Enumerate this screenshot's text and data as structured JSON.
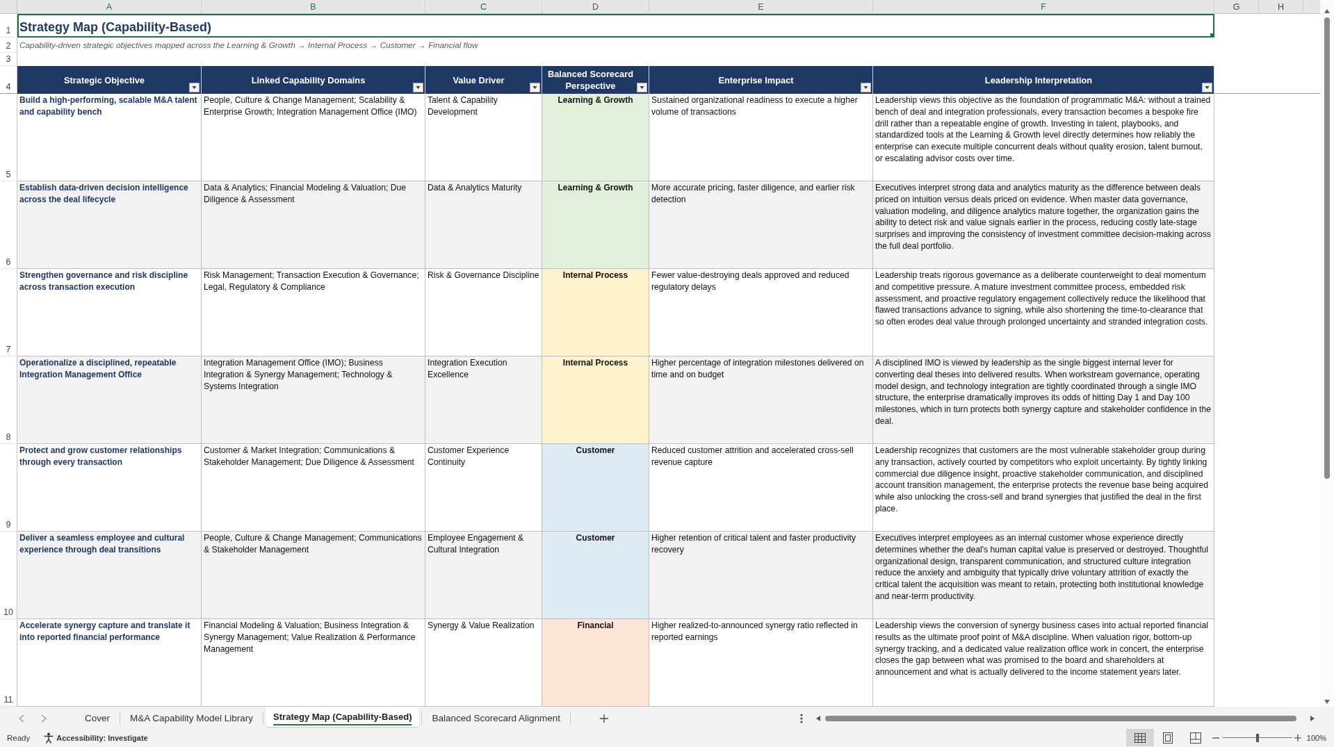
{
  "column_headers": [
    {
      "label": "A",
      "selected": true
    },
    {
      "label": "B",
      "selected": true
    },
    {
      "label": "C",
      "selected": true
    },
    {
      "label": "D",
      "selected": true
    },
    {
      "label": "E",
      "selected": true
    },
    {
      "label": "F",
      "selected": true
    },
    {
      "label": "G",
      "selected": false
    },
    {
      "label": "H",
      "selected": false
    }
  ],
  "row_headers": [
    {
      "label": "1",
      "selected": true
    },
    {
      "label": "2",
      "selected": false
    },
    {
      "label": "3",
      "selected": false
    },
    {
      "label": "4",
      "selected": false
    },
    {
      "label": "5",
      "selected": false
    },
    {
      "label": "6",
      "selected": false
    },
    {
      "label": "7",
      "selected": false
    },
    {
      "label": "8",
      "selected": false
    },
    {
      "label": "9",
      "selected": false
    },
    {
      "label": "10",
      "selected": false
    },
    {
      "label": "11",
      "selected": false
    }
  ],
  "title": {
    "text": "Strategy Map (Capability-Based)",
    "selected": true
  },
  "subtitle": "Capability-driven strategic objectives mapped across the Learning & Growth → Internal Process → Customer → Financial flow",
  "table": {
    "columns": [
      {
        "label": "Strategic Objective",
        "filter": true
      },
      {
        "label": "Linked Capability Domains",
        "filter": true
      },
      {
        "label": "Value Driver",
        "filter": true
      },
      {
        "label": "Balanced Scorecard Perspective",
        "filter": true
      },
      {
        "label": "Enterprise Impact",
        "filter": true
      },
      {
        "label": "Leadership Interpretation",
        "filter": true
      }
    ],
    "rows": [
      {
        "objective": "Build a high-performing, scalable M&A talent and capability bench",
        "capability_domains": "People, Culture & Change Management; Scalability & Enterprise Growth; Integration Management Office (IMO)",
        "value_driver": "Talent & Capability Development",
        "perspective": {
          "label": "Learning & Growth",
          "color": "#e2efda"
        },
        "enterprise_impact": "Sustained organizational readiness to execute a higher volume of transactions",
        "leadership_interpretation": "Leadership views this objective as the foundation of programmatic M&A: without a trained bench of deal and integration professionals, every transaction becomes a bespoke fire drill rather than a repeatable engine of growth. Investing in talent, playbooks, and standardized tools at the Learning & Growth level directly determines how reliably the enterprise can execute multiple concurrent deals without quality erosion, talent burnout, or escalating advisor costs over time."
      },
      {
        "objective": "Establish data-driven decision intelligence across the deal lifecycle",
        "capability_domains": "Data & Analytics; Financial Modeling & Valuation; Due Diligence & Assessment",
        "value_driver": "Data & Analytics Maturity",
        "perspective": {
          "label": "Learning & Growth",
          "color": "#e2efda"
        },
        "enterprise_impact": "More accurate pricing, faster diligence, and earlier risk detection",
        "leadership_interpretation": "Executives interpret strong data and analytics maturity as the difference between deals priced on intuition versus deals priced on evidence. When master data governance, valuation modeling, and diligence analytics mature together, the organization gains the ability to detect risk and value signals earlier in the process, reducing costly late-stage surprises and improving the consistency of investment committee decision-making across the full deal portfolio."
      },
      {
        "objective": "Strengthen governance and risk discipline across transaction execution",
        "capability_domains": "Risk Management; Transaction Execution & Governance; Legal, Regulatory & Compliance",
        "value_driver": "Risk & Governance Discipline",
        "perspective": {
          "label": "Internal Process",
          "color": "#fff2cc"
        },
        "enterprise_impact": "Fewer value-destroying deals approved and reduced regulatory delays",
        "leadership_interpretation": "Leadership treats rigorous governance as a deliberate counterweight to deal momentum and competitive pressure. A mature investment committee process, embedded risk assessment, and proactive regulatory engagement collectively reduce the likelihood that flawed transactions advance to signing, while also shortening the time-to-clearance that so often erodes deal value through prolonged uncertainty and stranded integration costs."
      },
      {
        "objective": "Operationalize a disciplined, repeatable Integration Management Office",
        "capability_domains": "Integration Management Office (IMO); Business Integration & Synergy Management; Technology & Systems Integration",
        "value_driver": "Integration Execution Excellence",
        "perspective": {
          "label": "Internal Process",
          "color": "#fff2cc"
        },
        "enterprise_impact": "Higher percentage of integration milestones delivered on time and on budget",
        "leadership_interpretation": "A disciplined IMO is viewed by leadership as the single biggest internal lever for converting deal theses into delivered results. When workstream governance, operating model design, and technology integration are tightly coordinated through a single IMO structure, the enterprise dramatically improves its odds of hitting Day 1 and Day 100 milestones, which in turn protects both synergy capture and stakeholder confidence in the deal."
      },
      {
        "objective": "Protect and grow customer relationships through every transaction",
        "capability_domains": "Customer & Market Integration; Communications & Stakeholder Management; Due Diligence & Assessment",
        "value_driver": "Customer Experience Continuity",
        "perspective": {
          "label": "Customer",
          "color": "#ddebf7"
        },
        "enterprise_impact": "Reduced customer attrition and accelerated cross-sell revenue capture",
        "leadership_interpretation": "Leadership recognizes that customers are the most vulnerable stakeholder group during any transaction, actively courted by competitors who exploit uncertainty. By tightly linking commercial due diligence insight, proactive stakeholder communication, and disciplined account transition management, the enterprise protects the revenue base being acquired while also unlocking the cross-sell and brand synergies that justified the deal in the first place."
      },
      {
        "objective": "Deliver a seamless employee and cultural experience through deal transitions",
        "capability_domains": "People, Culture & Change Management; Communications & Stakeholder Management",
        "value_driver": "Employee Engagement & Cultural Integration",
        "perspective": {
          "label": "Customer",
          "color": "#ddebf7"
        },
        "enterprise_impact": "Higher retention of critical talent and faster productivity recovery",
        "leadership_interpretation": "Executives interpret employees as an internal customer whose experience directly determines whether the deal's human capital value is preserved or destroyed. Thoughtful organizational design, transparent communication, and structured culture integration reduce the anxiety and ambiguity that typically drive voluntary attrition of exactly the critical talent the acquisition was meant to retain, protecting both institutional knowledge and near-term productivity."
      },
      {
        "objective": "Accelerate synergy capture and translate it into reported financial performance",
        "capability_domains": "Financial Modeling & Valuation; Business Integration & Synergy Management; Value Realization & Performance Management",
        "value_driver": "Synergy & Value Realization",
        "perspective": {
          "label": "Financial",
          "color": "#fce4d6"
        },
        "enterprise_impact": "Higher realized-to-announced synergy ratio reflected in reported earnings",
        "leadership_interpretation": "Leadership views the conversion of synergy business cases into actual reported financial results as the ultimate proof point of M&A discipline. When valuation rigor, bottom-up synergy tracking, and a dedicated value realization office work in concert, the enterprise closes the gap between what was promised to the board and shareholders at announcement and what is actually delivered to the income statement years later."
      }
    ]
  },
  "sheet_tabs": [
    {
      "label": "Cover",
      "selected": false
    },
    {
      "label": "M&A Capability Model Library",
      "selected": false
    },
    {
      "label": "Strategy Map (Capability-Based)",
      "selected": true
    },
    {
      "label": "Balanced Scorecard Alignment",
      "selected": false
    }
  ],
  "status_bar": {
    "status": "Ready",
    "accessibility": "Accessibility: Investigate",
    "view_buttons": [
      {
        "kind": "normal",
        "selected": true
      },
      {
        "kind": "page_layout",
        "selected": false
      },
      {
        "kind": "page_break",
        "selected": false
      }
    ],
    "zoom": {
      "level": 0.5,
      "reading": "100%"
    }
  }
}
